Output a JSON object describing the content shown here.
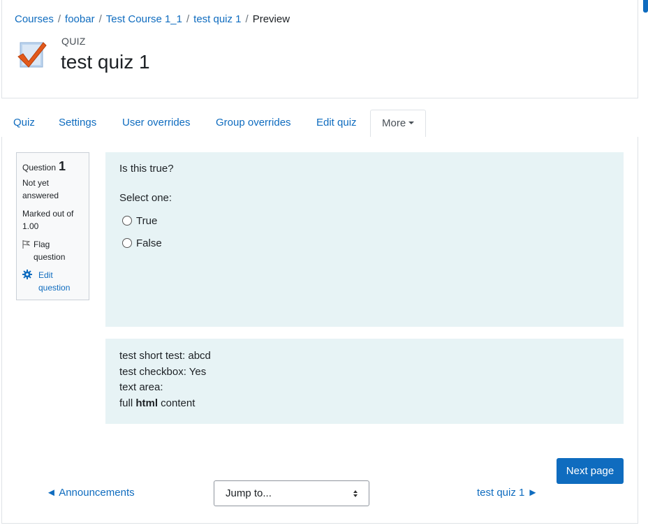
{
  "breadcrumb": {
    "items": [
      "Courses",
      "foobar",
      "Test Course 1_1",
      "test quiz 1"
    ],
    "separator": "/",
    "current": "Preview"
  },
  "header": {
    "kind": "QUIZ",
    "title": "test quiz 1",
    "icon": "quiz-checkmark-icon"
  },
  "tabs": {
    "items": [
      "Quiz",
      "Settings",
      "User overrides",
      "Group overrides",
      "Edit quiz"
    ],
    "more": "More",
    "active": "More"
  },
  "question_info": {
    "label": "Question",
    "number": "1",
    "state": "Not yet answered",
    "marks": "Marked out of 1.00",
    "flag": "Flag question",
    "edit": "Edit question"
  },
  "question": {
    "text": "Is this true?",
    "prompt": "Select one:",
    "options": [
      "True",
      "False"
    ]
  },
  "feedback": {
    "line1": "test short test: abcd",
    "line2": "test checkbox: Yes",
    "line3": "text area:",
    "line4_pre": "full ",
    "line4_bold": "html",
    "line4_post": " content"
  },
  "navigation": {
    "next_button": "Next page",
    "prev_arrow": "◄",
    "prev_label": "Announcements",
    "jump_placeholder": "Jump to...",
    "next_label": "test quiz 1",
    "next_arrow": "►"
  },
  "colors": {
    "link": "#0f6cbf",
    "primary": "#0f6cbf",
    "question_bg": "#e7f3f5",
    "info_bg": "#f8f9fa"
  }
}
